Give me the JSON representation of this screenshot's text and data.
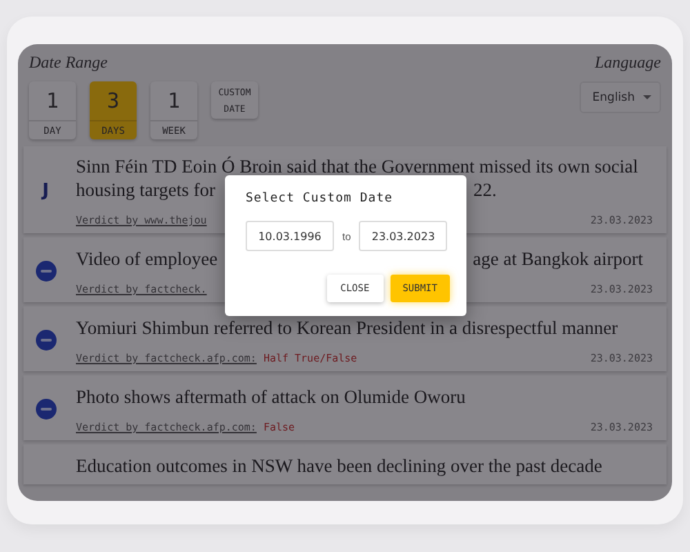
{
  "filters": {
    "label": "Date Range",
    "ranges": [
      {
        "number": "1",
        "unit": "DAY",
        "selected": false
      },
      {
        "number": "3",
        "unit": "DAYS",
        "selected": true
      },
      {
        "number": "1",
        "unit": "WEEK",
        "selected": false
      }
    ],
    "custom": {
      "line1": "CUSTOM",
      "line2": "DATE",
      "selected": false
    }
  },
  "language": {
    "label": "Language",
    "value": "English"
  },
  "items": [
    {
      "kind": "journal",
      "logo_text": "J",
      "title_lines": [
        "Sinn Féin TD Eoin Ó Broin said that the Government missed its own social",
        "housing targets for"
      ],
      "title_tail": "22.",
      "verdict_by": "Verdict by www.thejou",
      "date": "23.03.2023"
    },
    {
      "kind": "afp",
      "title_lines": [
        "Video of employee"
      ],
      "title_tail": "age at Bangkok airport",
      "verdict_by": "Verdict by factcheck.",
      "date": "23.03.2023"
    },
    {
      "kind": "afp",
      "title_lines": [
        "Yomiuri Shimbun referred to Korean President in a disrespectful manner"
      ],
      "verdict_by": "Verdict by factcheck.afp.com:",
      "verdict": "Half True/False",
      "date": "23.03.2023"
    },
    {
      "kind": "afp",
      "title_lines": [
        "Photo shows aftermath of attack on Olumide Oworu"
      ],
      "verdict_by": "Verdict by factcheck.afp.com:",
      "verdict": "False",
      "date": "23.03.2023"
    },
    {
      "title_lines": [
        "Education outcomes in NSW have been declining over the past decade"
      ]
    }
  ],
  "dialog": {
    "title": "Select Custom Date",
    "from": "10.03.1996",
    "separator": "to",
    "to": "23.03.2023",
    "buttons": [
      {
        "label": "CLOSE",
        "kind": "plain"
      },
      {
        "label": "SUBMIT",
        "kind": "primary"
      }
    ]
  }
}
